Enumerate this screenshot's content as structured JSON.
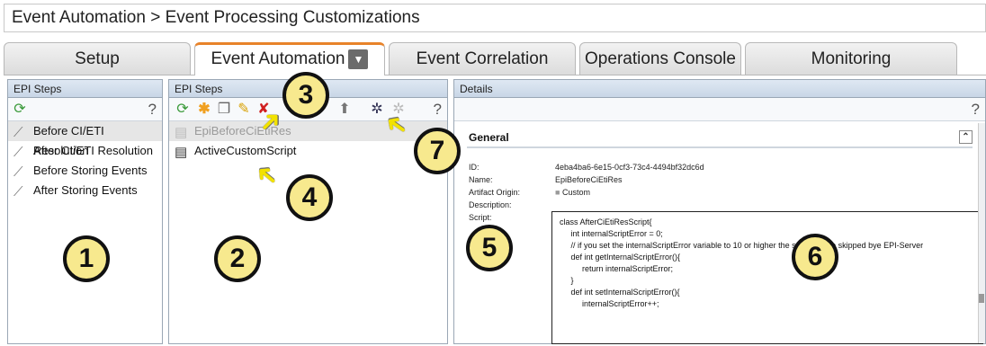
{
  "breadcrumb": "Event Automation > Event Processing Customizations",
  "tabs": [
    {
      "label": "Setup"
    },
    {
      "label": "Event Automation"
    },
    {
      "label": "Event Correlation"
    },
    {
      "label": "Operations Console"
    },
    {
      "label": "Monitoring"
    }
  ],
  "left_panel": {
    "title": "EPI Steps",
    "help": "?",
    "items": [
      {
        "label": "Before CI/ETI Resolution"
      },
      {
        "label": "After CI/ETI Resolution"
      },
      {
        "label": "Before Storing Events"
      },
      {
        "label": "After Storing Events"
      }
    ]
  },
  "middle_panel": {
    "title": "EPI Steps",
    "help": "?",
    "items": [
      {
        "label": "EpiBeforeCiEtiRes"
      },
      {
        "label": "ActiveCustomScript"
      }
    ]
  },
  "details": {
    "title": "Details",
    "help": "?",
    "section": "General",
    "fields": {
      "id_label": "ID:",
      "id_value": "4eba4ba6-6e15-0cf3-73c4-4494bf32dc6d",
      "name_label": "Name:",
      "name_value": "EpiBeforeCiEtiRes",
      "origin_label": "Artifact Origin:",
      "origin_value": "Custom",
      "description_label": "Description:",
      "script_label": "Script:"
    },
    "script_lines": [
      "class AfterCiEtiResScript{",
      "",
      "     int internalScriptError = 0;",
      "     // if you set the internalScriptError variable to 10 or higher the script will be skipped bye EPI-Server",
      "",
      "     def int getInternalScriptError(){",
      "          return internalScriptError;",
      "     }",
      "",
      "     def int setInternalScriptError(){",
      "          internalScriptError++;"
    ]
  },
  "callouts": [
    "1",
    "2",
    "3",
    "4",
    "5",
    "6",
    "7"
  ],
  "icons": {
    "refresh": "refresh-icon",
    "add": "add-icon",
    "copy": "copy-icon",
    "edit": "edit-icon",
    "delete": "delete-icon",
    "move_up": "move-up-icon",
    "activate": "gear-icon",
    "deactivate": "gear-disabled-icon"
  },
  "colors": {
    "active_tab_accent": "#e8832a",
    "panel_header": "#c8d6e6",
    "callout_fill": "#f7e98e",
    "arrow": "#f2e200"
  }
}
